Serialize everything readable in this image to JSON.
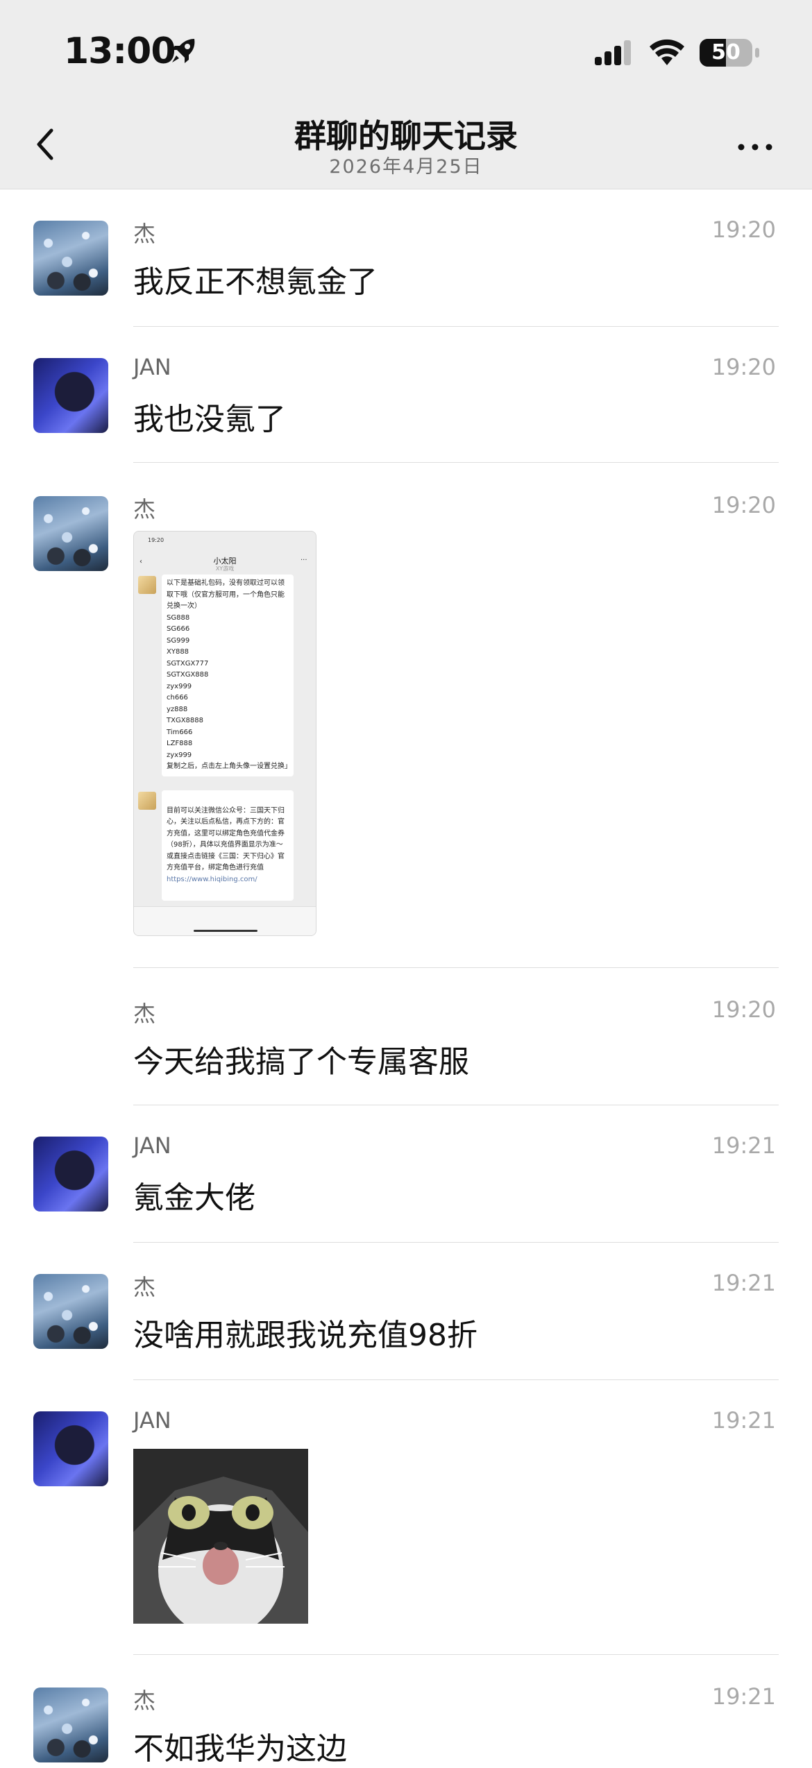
{
  "status": {
    "time": "13:00",
    "battery": "50",
    "battery_level": 0.5
  },
  "nav": {
    "title": "群聊的聊天记录",
    "date": "2026年4月25日"
  },
  "colors": {
    "header_bg": "#ededed",
    "jan_avatar_accent": "#3b46c9"
  },
  "messages": [
    {
      "sender": "杰",
      "time": "19:20",
      "text": "我反正不想氪金了"
    },
    {
      "sender": "JAN",
      "time": "19:20",
      "text": "我也没氪了"
    },
    {
      "sender": "杰",
      "time": "19:20"
    },
    {
      "sender": "杰",
      "time": "19:20",
      "text": "今天给我搞了个专属客服"
    },
    {
      "sender": "JAN",
      "time": "19:21",
      "text": "氪金大佬"
    },
    {
      "sender": "杰",
      "time": "19:21",
      "text": "没啥用就跟我说充值98折"
    },
    {
      "sender": "JAN",
      "time": "19:21"
    },
    {
      "sender": "杰",
      "time": "19:21",
      "text": "不如我华为这边"
    }
  ],
  "screenshot": {
    "time": "19:20",
    "title": "小太阳",
    "subtitle": "XY游戏",
    "bubble1": "以下是基础礼包码，没有领取过可以领取下哦（仅官方服可用，一个角色只能兑换一次）\nSG888\nSG666\nSG999\nXY888\nSGTXGX777\nSGTXGX888\nzyx999\nch666\nyz888\nTXGX8888\nTim666\nLZF888\nzyx999\n复制之后，点击左上角头像一设置兑换」",
    "bubble2": "目前可以关注微信公众号：三国天下归心，关注以后点私信，再点下方的：官方充值，这里可以绑定角色充值代金券（98折），具体以充值界面显示为准～\n或直接点击链接《三国：天下归心》官方充值平台，绑定角色进行充值",
    "link": "https://www.hiqibing.com/"
  }
}
